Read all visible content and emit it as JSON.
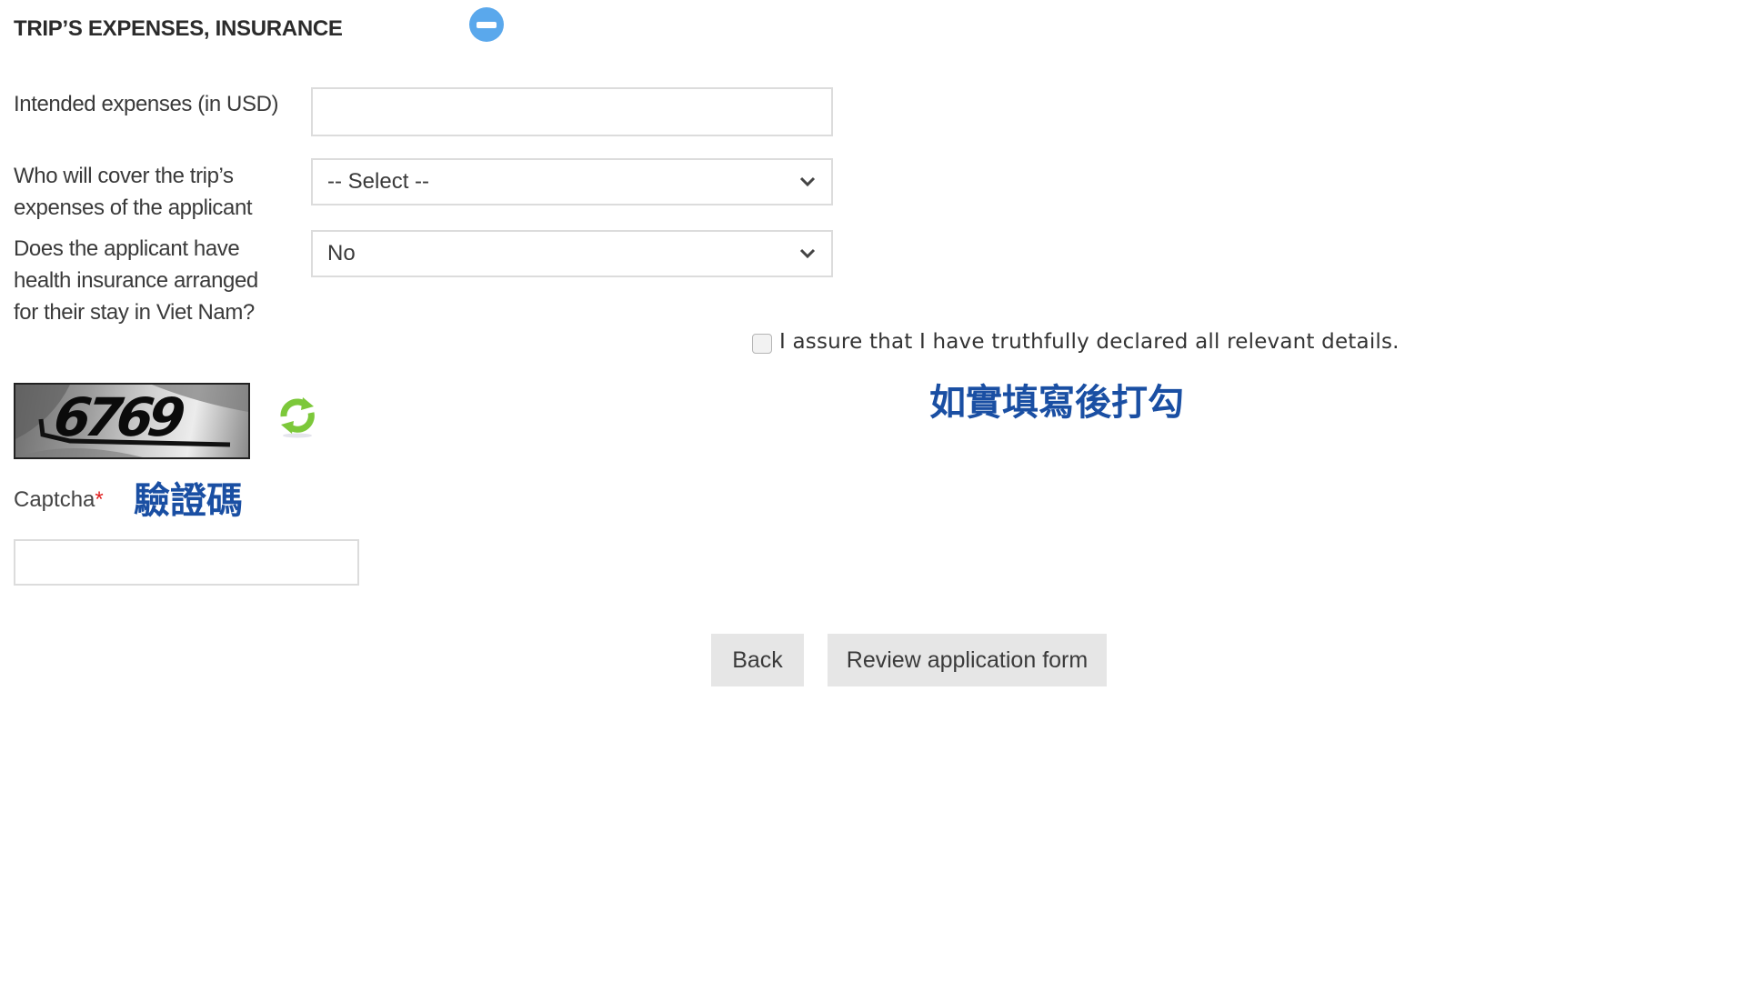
{
  "section": {
    "title": "TRIP’S EXPENSES, INSURANCE",
    "collapse_icon": "minus-circle-icon",
    "accent_color": "#5aa8ec"
  },
  "fields": {
    "expenses": {
      "label": "Intended expenses (in USD)",
      "value": "",
      "placeholder": ""
    },
    "coverer": {
      "label_lines": [
        "Who will cover the trip’s",
        "expenses of the applicant"
      ],
      "selected": "-- Select --"
    },
    "insurance": {
      "label_lines": [
        "Does the applicant have",
        "health insurance arranged",
        "for their stay in Viet Nam?"
      ],
      "selected": "No"
    }
  },
  "declaration": {
    "checked": false,
    "text": "I assure that I have truthfully declared all relevant details.",
    "annotation": "如實填寫後打勾"
  },
  "captcha": {
    "image_text": "6769",
    "refresh_icon": "refresh-icon",
    "label": "Captcha",
    "required_mark": "*",
    "annotation": "驗證碼",
    "value": ""
  },
  "buttons": {
    "back": "Back",
    "review": "Review application form"
  },
  "colors": {
    "annotation": "#1a4fa3",
    "required": "#e02020",
    "refresh": "#7cc83a"
  }
}
